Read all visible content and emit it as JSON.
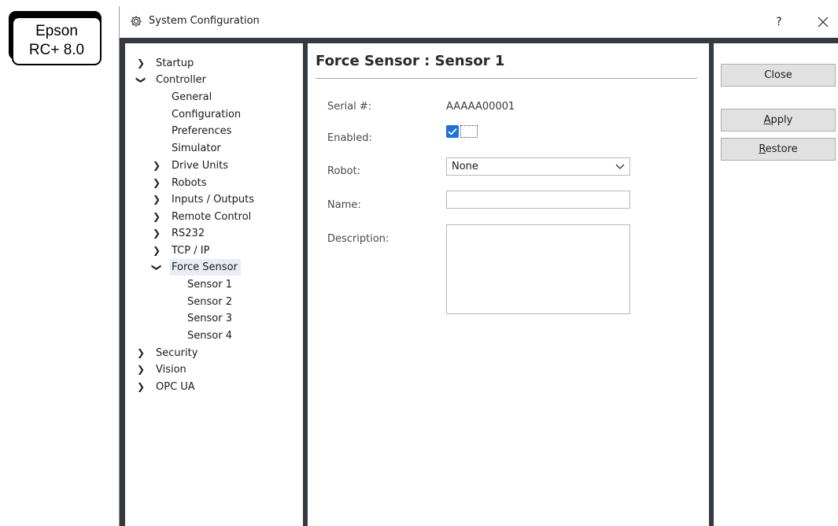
{
  "badge": {
    "line1": "Epson",
    "line2": "RC+ 8.0"
  },
  "window": {
    "title": "System Configuration",
    "help_label": "?",
    "close_label": "✕"
  },
  "tree": [
    {
      "label": "Startup",
      "chevron": "›",
      "expanded": false
    },
    {
      "label": "Controller",
      "chevron": "⌄",
      "expanded": true
    },
    {
      "label": "General"
    },
    {
      "label": "Configuration"
    },
    {
      "label": "Preferences"
    },
    {
      "label": "Simulator"
    },
    {
      "label": "Drive Units",
      "chevron": "›"
    },
    {
      "label": "Robots",
      "chevron": "›"
    },
    {
      "label": "Inputs / Outputs",
      "chevron": "›"
    },
    {
      "label": "Remote Control",
      "chevron": "›"
    },
    {
      "label": "RS232",
      "chevron": "›"
    },
    {
      "label": "TCP / IP",
      "chevron": "›"
    },
    {
      "label": "Force Sensor",
      "chevron": "⌄",
      "selected": true
    },
    {
      "label": "Sensor 1"
    },
    {
      "label": "Sensor 2"
    },
    {
      "label": "Sensor 3"
    },
    {
      "label": "Sensor 4"
    },
    {
      "label": "Security",
      "chevron": "›"
    },
    {
      "label": "Vision",
      "chevron": "›"
    },
    {
      "label": "OPC UA",
      "chevron": "›"
    }
  ],
  "content": {
    "heading": "Force Sensor : Sensor 1",
    "serial_label": "Serial #:",
    "serial_value": "AAAAA00001",
    "enabled_label": "Enabled:",
    "enabled_checked": true,
    "robot_label": "Robot:",
    "robot_value": "None",
    "name_label": "Name:",
    "name_value": "",
    "description_label": "Description:",
    "description_value": ""
  },
  "buttons": {
    "close": "Close",
    "apply_mnemonic": "A",
    "apply_rest": "pply",
    "restore_mnemonic": "R",
    "restore_rest": "estore"
  },
  "icons": {
    "title": "gear-icon",
    "dropdown": "chevron-down-icon",
    "collapsed": "chevron-right-icon",
    "expanded": "chevron-down-icon"
  },
  "colors": {
    "frame": "#343a40",
    "checkbox": "#1e72d6",
    "selected_row": "#e8ecf5"
  }
}
